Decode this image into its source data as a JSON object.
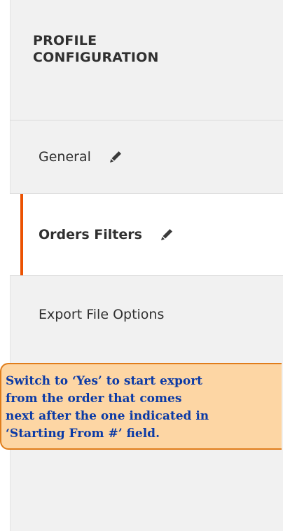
{
  "sidebar": {
    "title_line1": "PROFILE",
    "title_line2": "CONFIGURATION",
    "items": [
      {
        "label": "General",
        "icon": "pencil-icon"
      },
      {
        "label": "Orders Filters",
        "icon": "pencil-icon",
        "active": true
      },
      {
        "label": "Export File Options"
      }
    ]
  },
  "tooltip": {
    "lines": [
      "Switch to ‘Yes’ to start export",
      "from the order that comes",
      "next after the one indicated in",
      "‘Starting From #’ field."
    ]
  },
  "colors": {
    "accent": "#eb5202",
    "sidebar_bg": "#f1f1f1",
    "tooltip_bg": "#fdd6a4",
    "tooltip_border": "#e07d1b",
    "tooltip_text": "#0b3aa6"
  }
}
